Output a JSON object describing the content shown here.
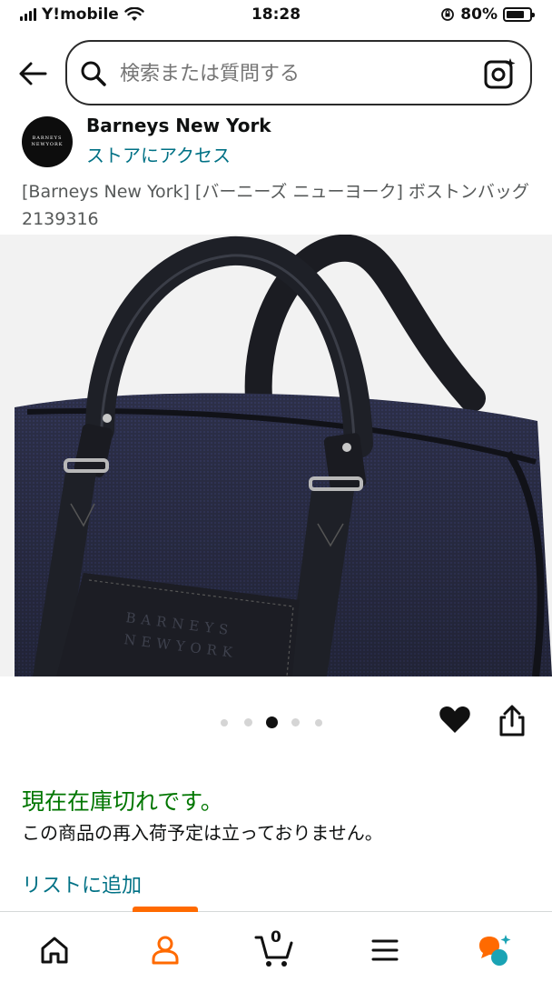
{
  "status_bar": {
    "carrier": "Y!mobile",
    "time": "18:28",
    "battery_percent": "80%",
    "battery_level": 0.8
  },
  "search": {
    "placeholder": "検索または質問する"
  },
  "store": {
    "name": "Barneys New York",
    "link_label": "ストアにアクセス",
    "logo_lines": [
      "BARNEYS",
      "NEWYORK"
    ]
  },
  "product": {
    "title": "[Barneys New York] [バーニーズ ニューヨーク] ボストンバッグ 2139316",
    "image_emboss_line1": "BARNEYS",
    "image_emboss_line2": "NEWYORK"
  },
  "carousel": {
    "total": 5,
    "active_index": 2
  },
  "availability": {
    "status": "現在在庫切れです。",
    "note": "この商品の再入荷予定は立っておりません。"
  },
  "actions": {
    "add_to_list": "リストに追加"
  },
  "bottom_nav": {
    "cart_count": "0",
    "active_tab": "profile"
  },
  "colors": {
    "link": "#007185",
    "in_stock_green": "#007600",
    "nav_accent": "#ff6a00"
  }
}
